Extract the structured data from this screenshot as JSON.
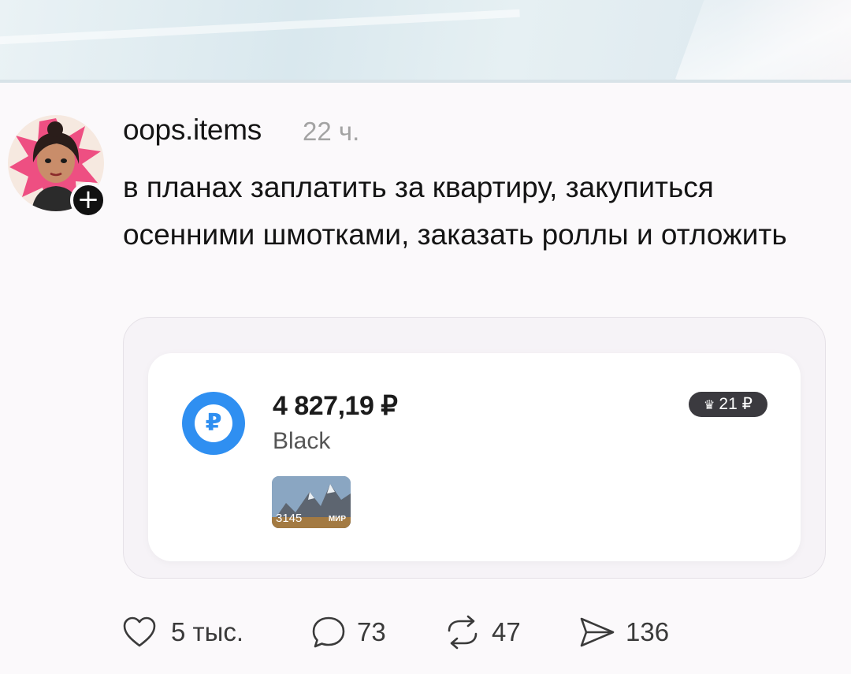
{
  "post": {
    "username": "oops.items",
    "time": "22 ч.",
    "text": "в планах заплатить за квартиру, закупиться осенними шмотками, заказать роллы и отложить",
    "follow_symbol": "+"
  },
  "card": {
    "balance": "4 827,19 ₽",
    "name": "Black",
    "currency_symbol": "₽",
    "cashback": "21 ₽",
    "mini_card_number": "3145",
    "mini_card_brand": "МИР"
  },
  "actions": {
    "likes": "5 тыс.",
    "comments": "73",
    "reposts": "47",
    "shares": "136"
  },
  "icons": {
    "like": "heart-icon",
    "comment": "comment-bubble-icon",
    "repost": "repost-icon",
    "share": "send-icon",
    "cashback": "crown-icon"
  },
  "colors": {
    "coin": "#2f8ff1",
    "cashback_badge": "#3b3a3f",
    "time": "#a3a3a3"
  }
}
